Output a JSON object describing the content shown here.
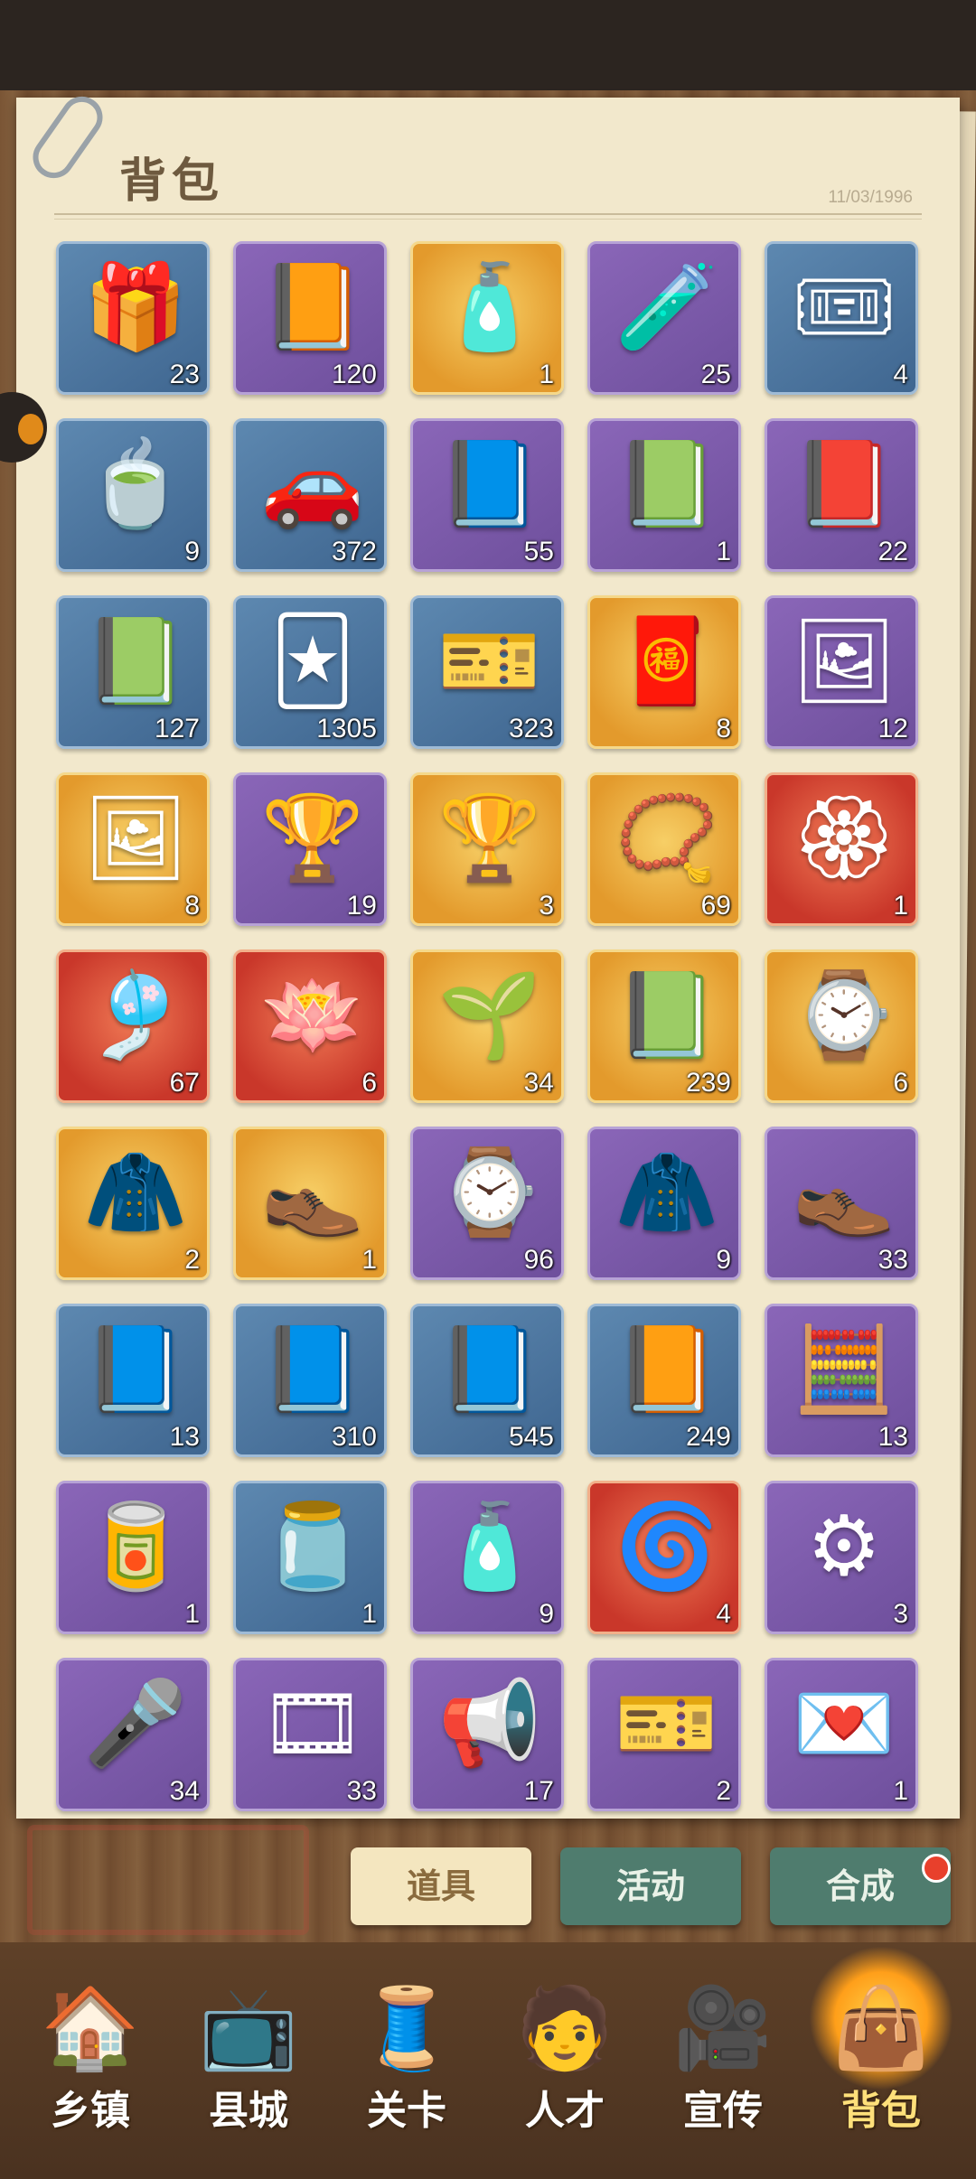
{
  "header": {
    "title": "背包",
    "date": "11/03/1996"
  },
  "tabs": [
    {
      "label": "道具",
      "active": true
    },
    {
      "label": "活动",
      "active": false
    },
    {
      "label": "合成",
      "active": false,
      "badge": true
    }
  ],
  "items": [
    {
      "icon": "gift-box-icon",
      "glyph": "🎁",
      "count": "23",
      "rarity": "blue"
    },
    {
      "icon": "career-book-icon",
      "glyph": "📙",
      "count": "120",
      "rarity": "purple"
    },
    {
      "icon": "tonic-bottle-icon",
      "glyph": "🧴",
      "count": "1",
      "rarity": "orange"
    },
    {
      "icon": "vial-icon",
      "glyph": "🧪",
      "count": "25",
      "rarity": "purple"
    },
    {
      "icon": "ginkgo-tickets-icon",
      "glyph": "🎟",
      "count": "4",
      "rarity": "blue"
    },
    {
      "icon": "tea-can-icon",
      "glyph": "🍵",
      "count": "9",
      "rarity": "blue"
    },
    {
      "icon": "parking-manual-icon",
      "glyph": "🚗",
      "count": "372",
      "rarity": "blue"
    },
    {
      "icon": "mystery-notebook-icon",
      "glyph": "📘",
      "count": "55",
      "rarity": "purple"
    },
    {
      "icon": "certificate-book-icon",
      "glyph": "📗",
      "count": "1",
      "rarity": "purple"
    },
    {
      "icon": "intermediate-economics-book-icon",
      "glyph": "📕",
      "count": "22",
      "rarity": "purple"
    },
    {
      "icon": "small-economics-book-icon",
      "glyph": "📗",
      "count": "127",
      "rarity": "blue"
    },
    {
      "icon": "score-card-icon",
      "glyph": "🃏",
      "count": "1305",
      "rarity": "blue"
    },
    {
      "icon": "ticket-upgrade-icon",
      "glyph": "🎫",
      "count": "323",
      "rarity": "blue"
    },
    {
      "icon": "scratch-lottery-icon",
      "glyph": "🧧",
      "count": "8",
      "rarity": "orange"
    },
    {
      "icon": "poster-fragment-icon",
      "glyph": "🖼",
      "count": "12",
      "rarity": "purple"
    },
    {
      "icon": "poster-icon",
      "glyph": "🖼",
      "count": "8",
      "rarity": "orange"
    },
    {
      "icon": "kungfu-statue-fragment-icon",
      "glyph": "🏆",
      "count": "19",
      "rarity": "purple"
    },
    {
      "icon": "kungfu-statue-icon",
      "glyph": "🏆",
      "count": "3",
      "rarity": "orange"
    },
    {
      "icon": "jade-pendant-icon",
      "glyph": "📿",
      "count": "69",
      "rarity": "orange"
    },
    {
      "icon": "command-token-icon",
      "glyph": "🏵",
      "count": "1",
      "rarity": "red"
    },
    {
      "icon": "zither-icon",
      "glyph": "🎐",
      "count": "67",
      "rarity": "red"
    },
    {
      "icon": "lotus-hat-icon",
      "glyph": "🪷",
      "count": "6",
      "rarity": "red"
    },
    {
      "icon": "ginseng-fragment-icon",
      "glyph": "🌱",
      "count": "34",
      "rarity": "orange"
    },
    {
      "icon": "wealth-book-icon",
      "glyph": "📗",
      "count": "239",
      "rarity": "orange"
    },
    {
      "icon": "luxury-watch-icon",
      "glyph": "⌚",
      "count": "6",
      "rarity": "orange"
    },
    {
      "icon": "black-suit-icon",
      "glyph": "🧥",
      "count": "2",
      "rarity": "orange"
    },
    {
      "icon": "leather-shoes-icon",
      "glyph": "👞",
      "count": "1",
      "rarity": "orange"
    },
    {
      "icon": "steel-watch-icon",
      "glyph": "⌚",
      "count": "96",
      "rarity": "purple"
    },
    {
      "icon": "grey-suit-icon",
      "glyph": "🧥",
      "count": "9",
      "rarity": "purple"
    },
    {
      "icon": "dress-shoes-icon",
      "glyph": "👞",
      "count": "33",
      "rarity": "purple"
    },
    {
      "icon": "farming-book-icon",
      "glyph": "📘",
      "count": "13",
      "rarity": "blue"
    },
    {
      "icon": "commerce-book-icon",
      "glyph": "📘",
      "count": "310",
      "rarity": "blue"
    },
    {
      "icon": "literature-book-icon",
      "glyph": "📘",
      "count": "545",
      "rarity": "blue"
    },
    {
      "icon": "sound-book-icon",
      "glyph": "📙",
      "count": "249",
      "rarity": "blue"
    },
    {
      "icon": "calculator-icon",
      "glyph": "🧮",
      "count": "13",
      "rarity": "purple"
    },
    {
      "icon": "skin-cream-icon",
      "glyph": "🥫",
      "count": "1",
      "rarity": "purple"
    },
    {
      "icon": "fragrance-cream-icon",
      "glyph": "🫙",
      "count": "1",
      "rarity": "blue"
    },
    {
      "icon": "spray-bottle-icon",
      "glyph": "🧴",
      "count": "9",
      "rarity": "purple"
    },
    {
      "icon": "turbocharger-icon",
      "glyph": "🌀",
      "count": "4",
      "rarity": "red"
    },
    {
      "icon": "gear-icon",
      "glyph": "⚙",
      "count": "3",
      "rarity": "purple"
    },
    {
      "icon": "microphone-icon",
      "glyph": "🎤",
      "count": "34",
      "rarity": "purple"
    },
    {
      "icon": "film-roll-icon",
      "glyph": "🎞",
      "count": "33",
      "rarity": "purple"
    },
    {
      "icon": "megaphone-icon",
      "glyph": "📢",
      "count": "17",
      "rarity": "purple"
    },
    {
      "icon": "train-ticket-icon",
      "glyph": "🎫",
      "count": "2",
      "rarity": "purple"
    },
    {
      "icon": "invitation-letter-icon",
      "glyph": "💌",
      "count": "1",
      "rarity": "purple"
    }
  ],
  "nav": [
    {
      "label": "乡镇",
      "icon": "town-house-icon",
      "glyph": "🏠",
      "active": false
    },
    {
      "label": "县城",
      "icon": "tv-icon",
      "glyph": "📺",
      "active": false
    },
    {
      "label": "关卡",
      "icon": "sewing-machine-icon",
      "glyph": "🧵",
      "active": false
    },
    {
      "label": "人才",
      "icon": "talent-portrait-icon",
      "glyph": "🧑",
      "active": false
    },
    {
      "label": "宣传",
      "icon": "film-camera-icon",
      "glyph": "🎥",
      "active": false
    },
    {
      "label": "背包",
      "icon": "backpack-icon",
      "glyph": "👜",
      "active": true
    }
  ]
}
